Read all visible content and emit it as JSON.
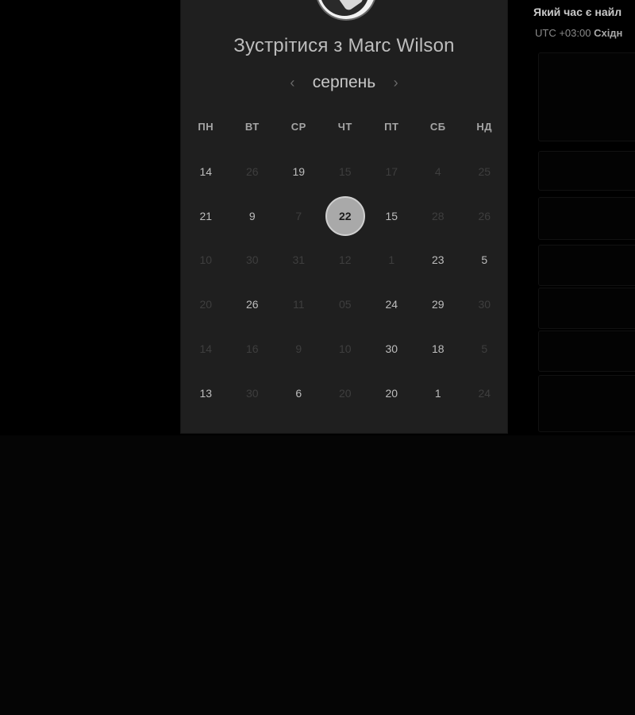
{
  "scheduler": {
    "title": "Зустрітися з Marc Wilson",
    "month": "серпень",
    "prev_arrow": "‹",
    "next_arrow": "›",
    "weekdays": [
      "ПН",
      "ВТ",
      "СР",
      "ЧТ",
      "ПТ",
      "СБ",
      "НД"
    ],
    "selected_day": "22",
    "days": [
      {
        "label": "14",
        "available": true
      },
      {
        "label": "26",
        "available": false
      },
      {
        "label": "19",
        "available": true
      },
      {
        "label": "15",
        "available": false
      },
      {
        "label": "17",
        "available": false
      },
      {
        "label": "4",
        "available": false
      },
      {
        "label": "25",
        "available": false
      },
      {
        "label": "21",
        "available": true
      },
      {
        "label": "9",
        "available": true
      },
      {
        "label": "7",
        "available": false
      },
      {
        "label": "22",
        "available": true
      },
      {
        "label": "15",
        "available": true
      },
      {
        "label": "28",
        "available": false
      },
      {
        "label": "26",
        "available": false
      },
      {
        "label": "10",
        "available": false
      },
      {
        "label": "30",
        "available": false
      },
      {
        "label": "31",
        "available": false
      },
      {
        "label": "12",
        "available": false
      },
      {
        "label": "1",
        "available": false
      },
      {
        "label": "23",
        "available": true
      },
      {
        "label": "5",
        "available": true
      },
      {
        "label": "20",
        "available": false
      },
      {
        "label": "26",
        "available": true
      },
      {
        "label": "11",
        "available": false
      },
      {
        "label": "05",
        "available": false
      },
      {
        "label": "24",
        "available": true
      },
      {
        "label": "29",
        "available": true
      },
      {
        "label": "30",
        "available": false
      },
      {
        "label": "14",
        "available": false
      },
      {
        "label": "16",
        "available": false
      },
      {
        "label": "9",
        "available": false
      },
      {
        "label": "10",
        "available": false
      },
      {
        "label": "30",
        "available": true
      },
      {
        "label": "18",
        "available": true
      },
      {
        "label": "5",
        "available": false
      },
      {
        "label": "13",
        "available": true
      },
      {
        "label": "30",
        "available": false
      },
      {
        "label": "6",
        "available": true
      },
      {
        "label": "20",
        "available": false
      },
      {
        "label": "20",
        "available": true
      },
      {
        "label": "1",
        "available": true
      },
      {
        "label": "24",
        "available": false
      }
    ]
  },
  "side": {
    "question": "Який час є найл",
    "timezone_prefix": "UTC +03:00",
    "timezone_name": "Східн"
  }
}
